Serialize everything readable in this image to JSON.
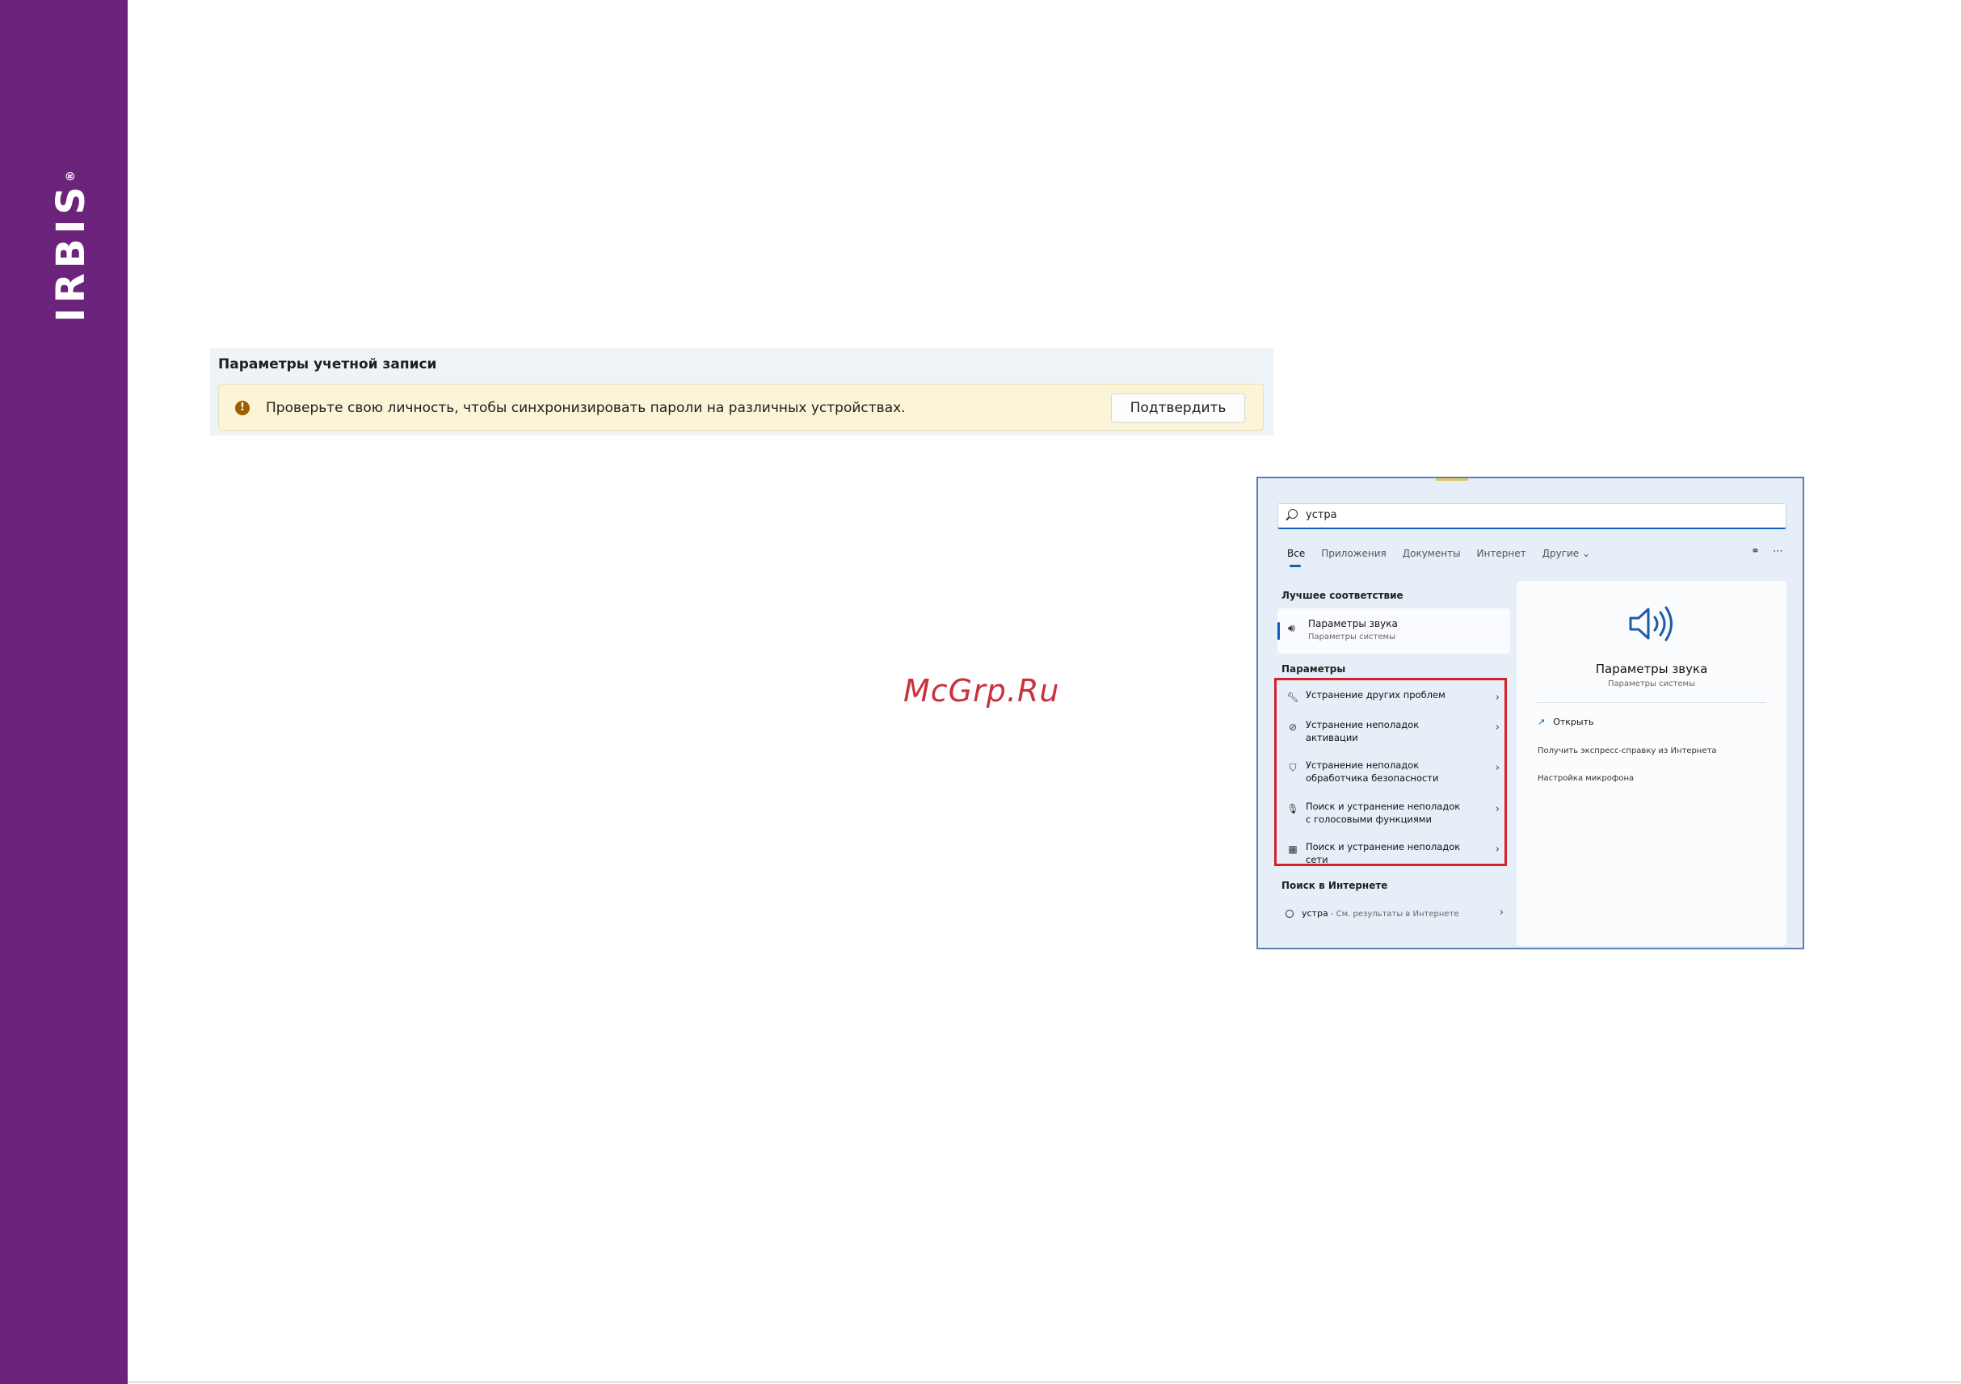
{
  "brand": {
    "logo_text": "IRBIS",
    "logo_mark": "®",
    "color": "#6b237b"
  },
  "account": {
    "title": "Параметры учетной записи",
    "banner_text": "Проверьте свою личность, чтобы синхронизировать пароли на различных устройствах.",
    "confirm_label": "Подтвердить",
    "warn_glyph": "!"
  },
  "watermark": "McGrp.Ru",
  "search": {
    "query": "устра",
    "tabs": [
      "Все",
      "Приложения",
      "Документы",
      "Интернет",
      "Другие ⌄"
    ],
    "best_match_heading": "Лучшее соответствие",
    "best_match": {
      "title": "Параметры звука",
      "subtitle": "Параметры системы"
    },
    "params_heading": "Параметры",
    "params_items": [
      "Устранение других проблем",
      "Устранение неполадок активации",
      "Устранение неполадок обработчика безопасности",
      "Поиск и устранение неполадок с голосовыми функциями",
      "Поиск и устранение неполадок сети"
    ],
    "web_heading": "Поиск в Интернете",
    "web_item": {
      "query": "устра",
      "suffix": " - См. результаты в Интернете"
    },
    "preview": {
      "title": "Параметры звука",
      "subtitle": "Параметры системы",
      "open_label": "Открыть",
      "link1": "Получить экспресс-справку из Интернета",
      "link2": "Настройка микрофона"
    }
  }
}
